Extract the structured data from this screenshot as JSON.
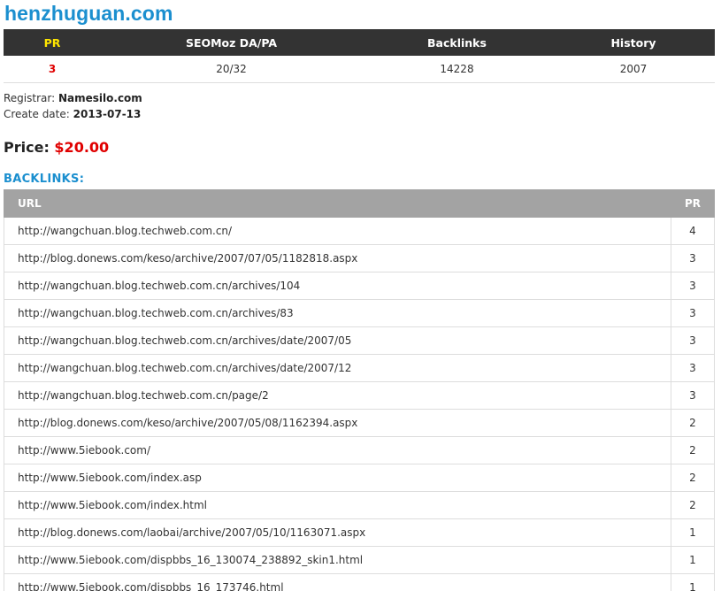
{
  "domain": "henzhuguan.com",
  "stats": {
    "headers": {
      "pr": "PR",
      "seomoz": "SEOMoz DA/PA",
      "backlinks": "Backlinks",
      "history": "History"
    },
    "values": {
      "pr": "3",
      "seomoz": "20/32",
      "backlinks": "14228",
      "history": "2007"
    }
  },
  "registrar": {
    "label": "Registrar:",
    "value": "Namesilo.com"
  },
  "create_date": {
    "label": "Create date:",
    "value": "2013-07-13"
  },
  "price": {
    "label": "Price:",
    "value": "$20.00"
  },
  "backlinks_heading": "BACKLINKS:",
  "backlinks_table": {
    "headers": {
      "url": "URL",
      "pr": "PR"
    },
    "rows": [
      {
        "url": "http://wangchuan.blog.techweb.com.cn/",
        "pr": "4"
      },
      {
        "url": "http://blog.donews.com/keso/archive/2007/07/05/1182818.aspx",
        "pr": "3"
      },
      {
        "url": "http://wangchuan.blog.techweb.com.cn/archives/104",
        "pr": "3"
      },
      {
        "url": "http://wangchuan.blog.techweb.com.cn/archives/83",
        "pr": "3"
      },
      {
        "url": "http://wangchuan.blog.techweb.com.cn/archives/date/2007/05",
        "pr": "3"
      },
      {
        "url": "http://wangchuan.blog.techweb.com.cn/archives/date/2007/12",
        "pr": "3"
      },
      {
        "url": "http://wangchuan.blog.techweb.com.cn/page/2",
        "pr": "3"
      },
      {
        "url": "http://blog.donews.com/keso/archive/2007/05/08/1162394.aspx",
        "pr": "2"
      },
      {
        "url": "http://www.5iebook.com/",
        "pr": "2"
      },
      {
        "url": "http://www.5iebook.com/index.asp",
        "pr": "2"
      },
      {
        "url": "http://www.5iebook.com/index.html",
        "pr": "2"
      },
      {
        "url": "http://blog.donews.com/laobai/archive/2007/05/10/1163071.aspx",
        "pr": "1"
      },
      {
        "url": "http://www.5iebook.com/dispbbs_16_130074_238892_skin1.html",
        "pr": "1"
      },
      {
        "url": "http://www.5iebook.com/dispbbs_16_173746.html",
        "pr": "1"
      }
    ]
  },
  "colors": {
    "domain_title": "#1b8fcf",
    "stats_header_bg": "#333333",
    "pr_header": "#ffe600",
    "pr_value": "#e00000",
    "price_value": "#e00000",
    "backlinks_header_bg": "#a3a3a3"
  }
}
